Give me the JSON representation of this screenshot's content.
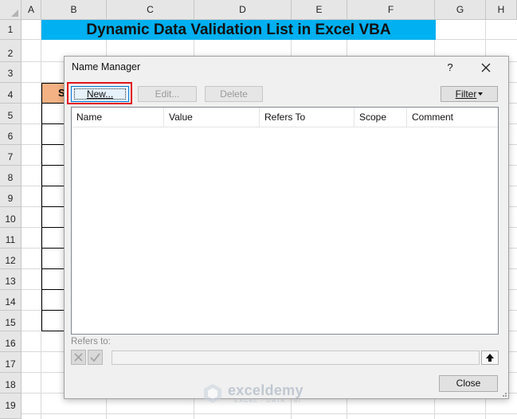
{
  "spreadsheet": {
    "columns": [
      "A",
      "B",
      "C",
      "D",
      "E",
      "F",
      "G",
      "H"
    ],
    "rows": [
      "1",
      "2",
      "3",
      "4",
      "5",
      "6",
      "7",
      "8",
      "9",
      "10",
      "11",
      "12",
      "13",
      "14",
      "15",
      "16",
      "17",
      "18",
      "19"
    ],
    "title": "Dynamic Data Validation List in Excel VBA",
    "table_header_partial": "S",
    "colors": {
      "title_fill": "#00b0f0",
      "table_header_fill": "#f4b183"
    }
  },
  "dialog": {
    "title": "Name Manager",
    "help_label": "?",
    "close_icon": "close-icon",
    "buttons": {
      "new": "New...",
      "edit": "Edit...",
      "delete": "Delete",
      "filter": "Filter"
    },
    "columns": [
      "Name",
      "Value",
      "Refers To",
      "Scope",
      "Comment"
    ],
    "refers_to_label": "Refers to:",
    "close_button": "Close",
    "highlight_color": "#e0141e"
  },
  "watermark": {
    "name": "exceldemy",
    "tagline": "EXCEL · DATA · BI"
  }
}
